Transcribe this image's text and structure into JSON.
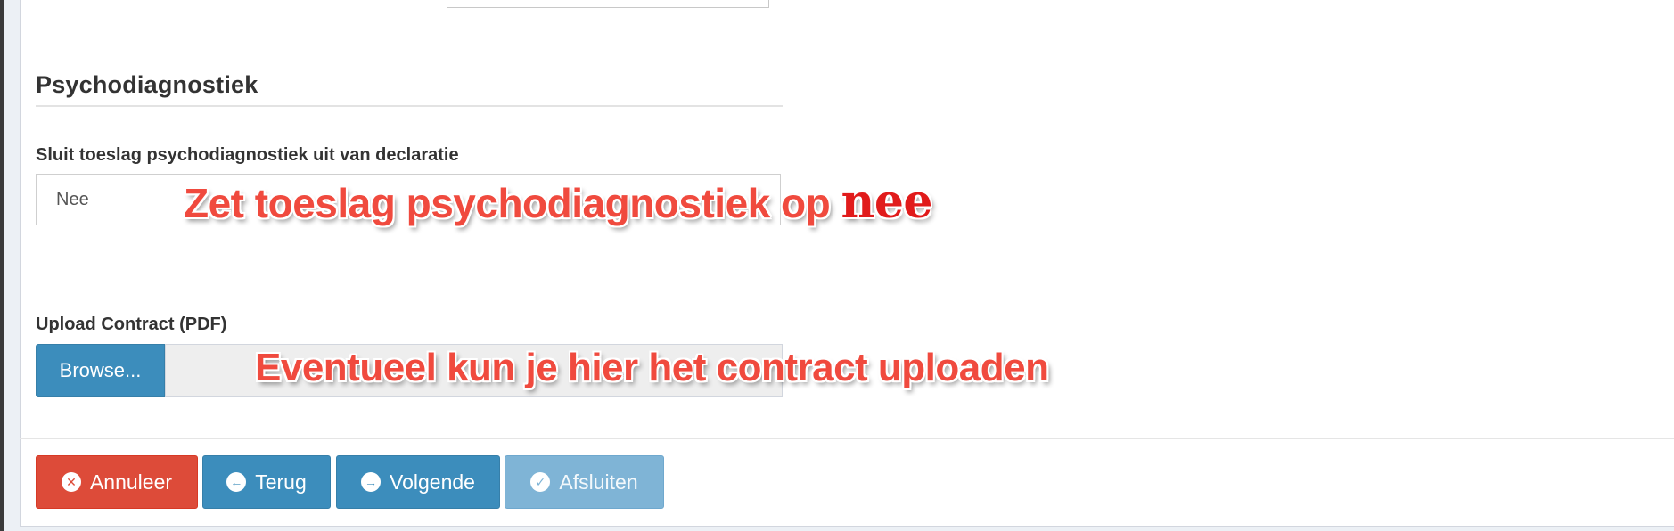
{
  "section": {
    "title": "Psychodiagnostiek"
  },
  "toeslag_field": {
    "label": "Sluit toeslag psychodiagnostiek uit van declaratie",
    "value": "Nee"
  },
  "upload_field": {
    "label": "Upload Contract (PDF)",
    "browse_label": "Browse...",
    "file_name": ""
  },
  "actions": {
    "cancel": {
      "label": "Annuleer",
      "icon": "times-circle-icon",
      "color": "#dd4b39"
    },
    "back": {
      "label": "Terug",
      "icon": "arrow-circle-left-icon",
      "color": "#3c8dbc"
    },
    "next": {
      "label": "Volgende",
      "icon": "arrow-circle-right-icon",
      "color": "#3c8dbc"
    },
    "finish": {
      "label": "Afsluiten",
      "icon": "check-circle-icon",
      "color": "#7fb4d6",
      "disabled": true
    }
  },
  "annotations": {
    "toeslag_note_main": "Zet toeslag psychodiagnostiek op",
    "toeslag_note_emph": "nee",
    "upload_note": "Eventueel kun je hier het contract uploaden"
  }
}
